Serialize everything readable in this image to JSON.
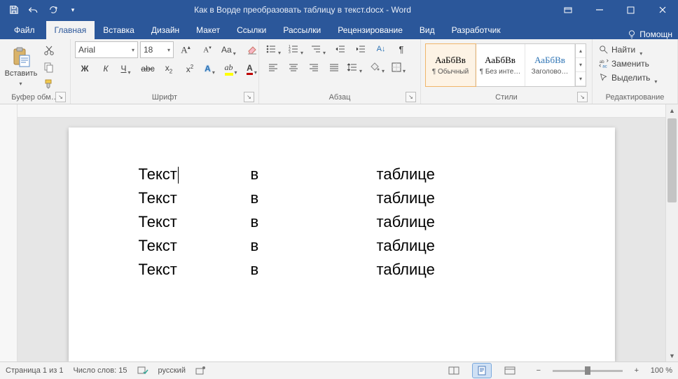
{
  "title": "Как в Ворде преобразовать таблицу в текст.docx - Word",
  "tabs": {
    "file": "Файл",
    "home": "Главная",
    "insert": "Вставка",
    "design": "Дизайн",
    "layout": "Макет",
    "references": "Ссылки",
    "mailings": "Рассылки",
    "review": "Рецензирование",
    "view": "Вид",
    "developer": "Разработчик",
    "help_label": "Помощн"
  },
  "ribbon": {
    "clipboard": {
      "label": "Буфер обм…",
      "paste": "Вставить"
    },
    "font": {
      "label": "Шрифт",
      "family": "Arial",
      "size": "18",
      "bold": "Ж",
      "italic": "К",
      "underline": "Ч",
      "strike": "abc"
    },
    "paragraph": {
      "label": "Абзац"
    },
    "styles": {
      "label": "Стили",
      "items": [
        {
          "preview": "АаБбВв",
          "name": "¶ Обычный",
          "selected": true,
          "color": "#000"
        },
        {
          "preview": "АаБбВв",
          "name": "¶ Без инте…",
          "selected": false,
          "color": "#000"
        },
        {
          "preview": "АаБбВв",
          "name": "Заголово…",
          "selected": false,
          "color": "#2e74b5"
        }
      ]
    },
    "editing": {
      "label": "Редактирование",
      "find": "Найти",
      "replace": "Заменить",
      "select": "Выделить"
    }
  },
  "document": {
    "rows": [
      {
        "c1": "Текст",
        "c2": "в",
        "c3": "таблице"
      },
      {
        "c1": "Текст",
        "c2": "в",
        "c3": "таблице"
      },
      {
        "c1": "Текст",
        "c2": "в",
        "c3": "таблице"
      },
      {
        "c1": "Текст",
        "c2": "в",
        "c3": "таблице"
      },
      {
        "c1": "Текст",
        "c2": "в",
        "c3": "таблице"
      }
    ]
  },
  "status": {
    "page": "Страница 1 из 1",
    "words": "Число слов: 15",
    "lang": "русский",
    "zoom": "100 %"
  }
}
